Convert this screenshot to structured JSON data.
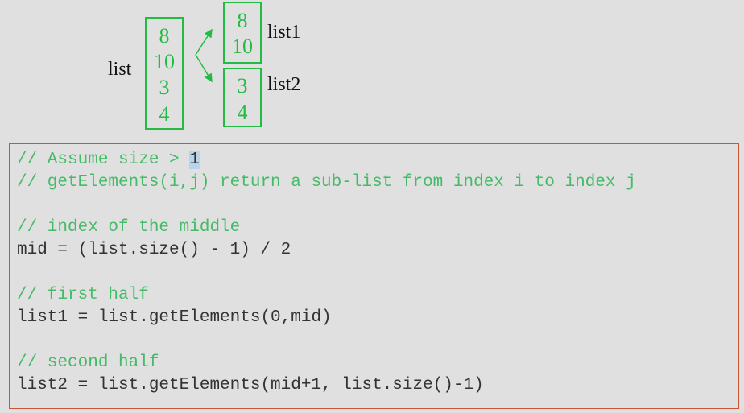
{
  "diagram": {
    "list_label": "list",
    "list1_label": "list1",
    "list2_label": "list2",
    "list_items": [
      "8",
      "10",
      "3",
      "4"
    ],
    "list1_items": [
      "8",
      "10"
    ],
    "list2_items": [
      "3",
      "4"
    ]
  },
  "code": {
    "line1_prefix": "// Assume size > ",
    "line1_highlight": "1",
    "line2": "// getElements(i,j) return a sub-list from index i to index j",
    "line3": "// index of the middle",
    "line4": "mid = (list.size() - 1) / 2",
    "line5": "// first half",
    "line6": "list1 = list.getElements(0,mid)",
    "line7": "// second half",
    "line8": "list2 = list.getElements(mid+1, list.size()-1)"
  },
  "colors": {
    "box_green": "#22bb44",
    "comment_green": "#44bb66",
    "code_dark": "#333333",
    "code_border": "#cc5533",
    "background": "#e0e0e0"
  }
}
